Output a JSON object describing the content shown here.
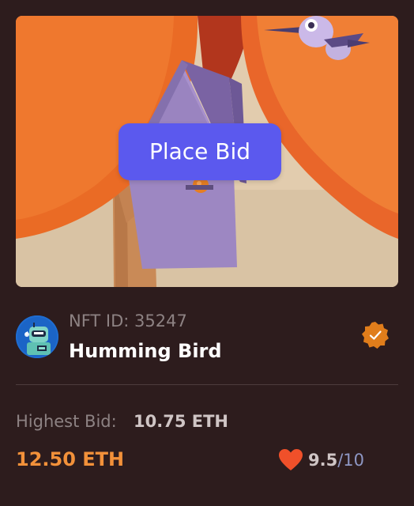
{
  "artwork": {
    "place_bid_label": "Place Bid"
  },
  "nft": {
    "id_text": "NFT ID: 35247",
    "name": "Humming Bird",
    "avatar_icon": "robot-avatar-icon",
    "verified_icon": "verified-badge-icon"
  },
  "bid": {
    "highest_label": "Highest Bid:",
    "highest_value": "10.75 ETH",
    "price": "12.50 ETH"
  },
  "rating": {
    "icon": "heart-icon",
    "score": "9.5",
    "separator": "/",
    "max": "10"
  },
  "colors": {
    "background": "#2d1c1d",
    "accent_button": "#5b59ee",
    "price": "#f2913a",
    "heart": "#f0502a",
    "verified": "#e07d1b"
  }
}
